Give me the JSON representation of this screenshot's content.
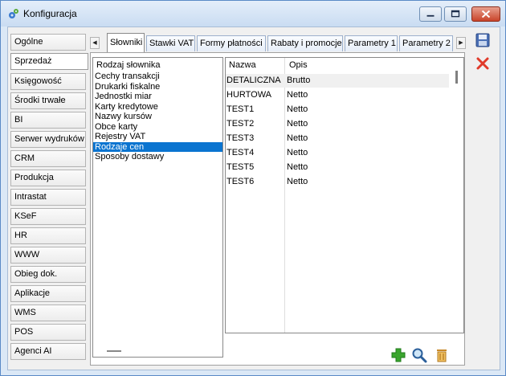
{
  "window": {
    "title": "Konfiguracja"
  },
  "nav": {
    "items": [
      {
        "label": "Ogólne",
        "active": false
      },
      {
        "label": "Sprzedaż",
        "active": true
      },
      {
        "label": "Księgowość",
        "active": false
      },
      {
        "label": "Środki trwałe",
        "active": false
      },
      {
        "label": "BI",
        "active": false
      },
      {
        "label": "Serwer wydruków",
        "active": false
      },
      {
        "label": "CRM",
        "active": false
      },
      {
        "label": "Produkcja",
        "active": false
      },
      {
        "label": "Intrastat",
        "active": false
      },
      {
        "label": "KSeF",
        "active": false
      },
      {
        "label": "HR",
        "active": false
      },
      {
        "label": "WWW",
        "active": false
      },
      {
        "label": "Obieg dok.",
        "active": false
      },
      {
        "label": "Aplikacje",
        "active": false
      },
      {
        "label": "WMS",
        "active": false
      },
      {
        "label": "POS",
        "active": false
      },
      {
        "label": "Agenci AI",
        "active": false
      }
    ]
  },
  "tabs": [
    {
      "label": "Słowniki",
      "active": true
    },
    {
      "label": "Stawki VAT",
      "active": false
    },
    {
      "label": "Formy płatności",
      "active": false
    },
    {
      "label": "Rabaty i promocje",
      "active": false
    },
    {
      "label": "Parametry 1",
      "active": false
    },
    {
      "label": "Parametry 2",
      "active": false
    }
  ],
  "dictionaries": {
    "header": "Rodzaj słownika",
    "items": [
      {
        "label": "Cechy transakcji",
        "selected": false
      },
      {
        "label": "Drukarki fiskalne",
        "selected": false
      },
      {
        "label": "Jednostki miar",
        "selected": false
      },
      {
        "label": "Karty kredytowe",
        "selected": false
      },
      {
        "label": "Nazwy kursów",
        "selected": false
      },
      {
        "label": "Obce karty",
        "selected": false
      },
      {
        "label": "Rejestry VAT",
        "selected": false
      },
      {
        "label": "Rodzaje cen",
        "selected": true
      },
      {
        "label": "Sposoby dostawy",
        "selected": false
      }
    ]
  },
  "grid": {
    "columns": [
      "Nazwa",
      "Opis"
    ],
    "rows": [
      [
        "DETALICZNA",
        "Brutto"
      ],
      [
        "HURTOWA",
        "Netto"
      ],
      [
        "TEST1",
        "Netto"
      ],
      [
        "TEST2",
        "Netto"
      ],
      [
        "TEST3",
        "Netto"
      ],
      [
        "TEST4",
        "Netto"
      ],
      [
        "TEST5",
        "Netto"
      ],
      [
        "TEST6",
        "Netto"
      ]
    ]
  },
  "icons": {
    "app": "gear-icon",
    "save": "floppy-disk-icon",
    "cancel": "red-x-icon",
    "add": "green-plus-icon",
    "search": "magnifier-icon",
    "delete": "trash-icon"
  },
  "colors": {
    "selection": "#0a74d0",
    "accent_green": "#3aa52e",
    "cancel_red": "#e03a2a"
  }
}
